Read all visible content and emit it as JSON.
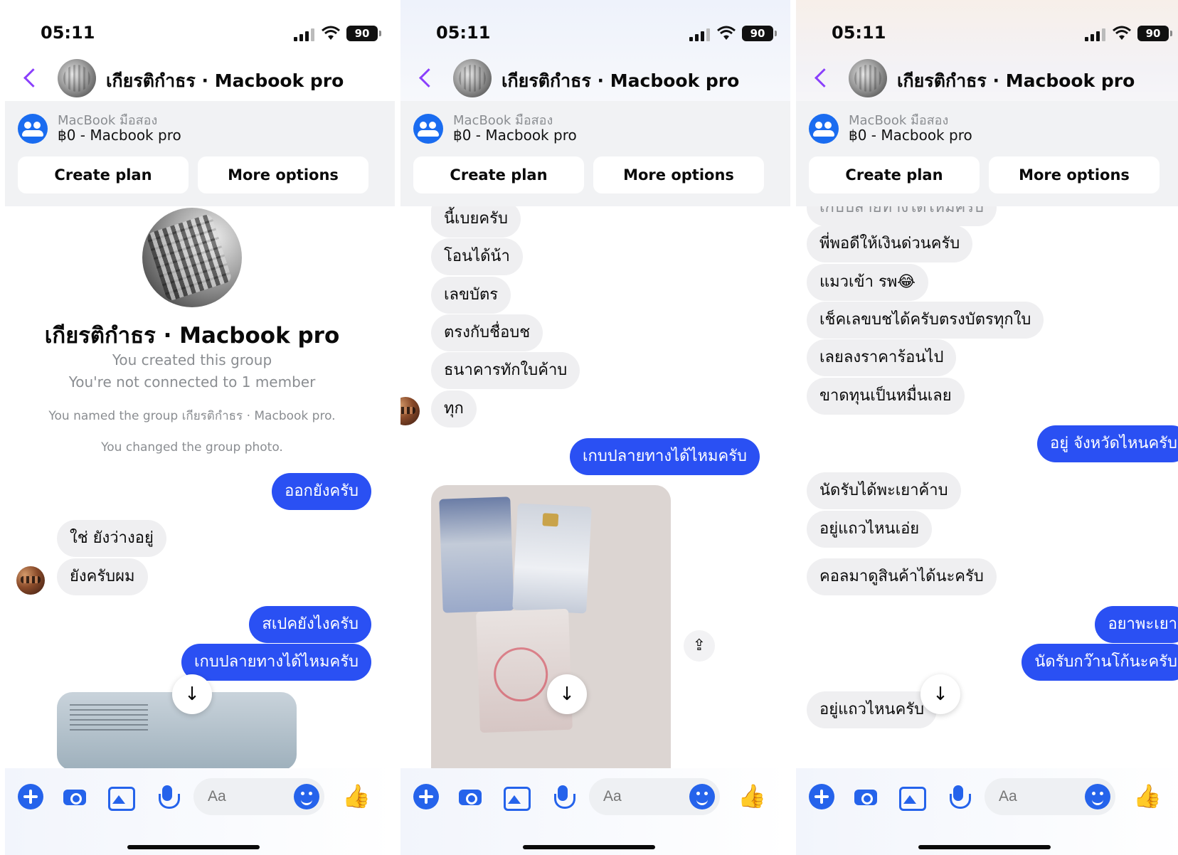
{
  "status": {
    "time": "05:11",
    "battery": "90"
  },
  "header": {
    "title": "เกียรติกำธร · Macbook pro"
  },
  "listing": {
    "subtitle": "MacBook มือสอง",
    "title": "฿0 - Macbook pro"
  },
  "actions": {
    "create_plan": "Create plan",
    "more_options": "More options"
  },
  "composer": {
    "placeholder": "Aa",
    "like_glyph": "👍"
  },
  "icons": {
    "back": "chevron-left-icon",
    "share": "share-icon",
    "scroll": "arrow-down-icon"
  },
  "colors": {
    "accent": "#2a50f3",
    "back": "#8a3ffc",
    "incoming": "#efeff1"
  },
  "screens": [
    {
      "profile_name": "เกียรติกำธร · Macbook pro",
      "notes": [
        "You created this group",
        "You're not connected to 1 member",
        "You named the group เกียรติกำธร · Macbook pro.",
        "You changed the group photo."
      ],
      "messages": [
        "ออกยังครับ",
        "ใช่ ยังว่างอยู่",
        "ยังครับผม",
        "สเปคยังไงครับ",
        "เกบปลายทางได้ไหมครับ"
      ]
    },
    {
      "messages": [
        "นี้เบยครับ",
        "โอนได้น้า",
        "เลขบัตร",
        "ตรงกับชื่อบช",
        "ธนาคารทักใบค้าบ",
        "ทุก",
        "เกบปลายทางได้ไหมครับ"
      ]
    },
    {
      "messages": [
        "เกบปลายทางได้ไหมครับ",
        "พี่พอดีให้เงินด่วนครับ",
        "แมวเข้า รพ😂",
        "เช็คเลขบชได้ครับตรงบัตรทุกใบ",
        "เลยลงราคาร้อนไป",
        "ขาดทุนเป็นหมื่นเลย",
        "อยู่ จังหวัดไหนครับ",
        "นัดรับได้พะเยาค้าบ",
        "อยู่แถวไหนเอ่ย",
        "คอลมาดูสินค้าได้นะครับ",
        "อยาพะเยา",
        "นัดรับกว๊านโก้นะครับ",
        "อยู่แถวไหนครับ"
      ]
    }
  ]
}
